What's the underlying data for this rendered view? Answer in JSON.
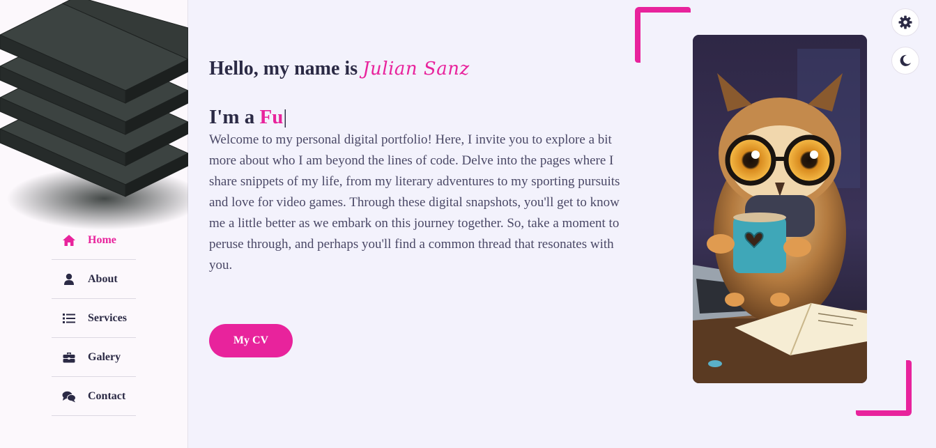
{
  "sidebar": {
    "nav": [
      {
        "label": "Home",
        "icon": "home-icon",
        "active": true
      },
      {
        "label": "About",
        "icon": "user-icon",
        "active": false
      },
      {
        "label": "Services",
        "icon": "list-icon",
        "active": false
      },
      {
        "label": "Galery",
        "icon": "briefcase-icon",
        "active": false
      },
      {
        "label": "Contact",
        "icon": "comments-icon",
        "active": false
      }
    ]
  },
  "hero": {
    "greeting": "Hello, my name is ",
    "name": "Julian Sanz",
    "role_prefix": "I'm a ",
    "role_typed": "Fu",
    "cursor": "|",
    "intro": "Welcome to my personal digital portfolio! Here, I invite you to explore a bit more about who I am beyond the lines of code. Delve into the pages where I share snippets of my life, from my literary adventures to my sporting pursuits and love for video games. Through these digital snapshots, you'll get to know me a little better as we embark on this journey together. So, take a moment to peruse through, and perhaps you'll find a common thread that resonates with you.",
    "cv_button": "My CV"
  },
  "controls": {
    "settings_icon": "gear-icon",
    "theme_icon": "moon-icon"
  },
  "colors": {
    "accent": "#e8239c",
    "text": "#2b2a45",
    "background": "#f3f2fc"
  }
}
